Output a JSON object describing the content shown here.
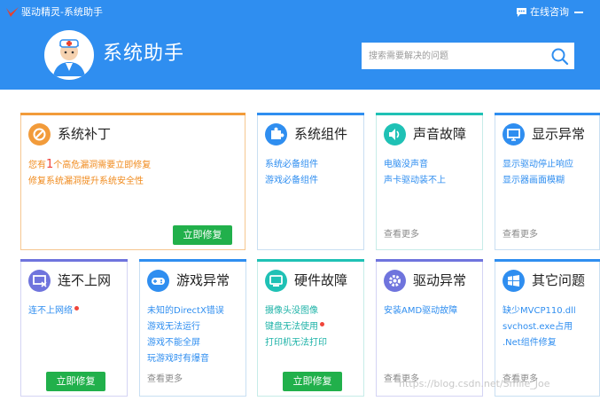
{
  "titlebar": {
    "app_name": "驱动精灵-系统助手",
    "online_label": "在线咨询"
  },
  "header": {
    "title": "系统助手"
  },
  "search": {
    "placeholder": "搜索需要解决的问题"
  },
  "colors": {
    "header": "#2f8ef0",
    "patch": "#f29b3a",
    "link": "#2f8ef0",
    "button": "#21b04b",
    "red_dot": "#f0453a"
  },
  "cards": {
    "patch": {
      "title": "系统补丁",
      "warning": {
        "prefix": "您有",
        "count": "1",
        "suffix": "个高危漏洞需要立即修复"
      },
      "line2": "修复系统漏洞提升系统安全性",
      "button": "立即修复",
      "icon": "wrench-icon"
    },
    "components": {
      "title": "系统组件",
      "items": [
        "系统必备组件",
        "游戏必备组件"
      ],
      "icon": "puzzle-icon"
    },
    "sound": {
      "title": "声音故障",
      "items": [
        "电脑没声音",
        "声卡驱动装不上"
      ],
      "more": "查看更多",
      "icon": "speaker-icon"
    },
    "display": {
      "title": "显示异常",
      "items": [
        "显示驱动停止响应",
        "显示器画面模糊"
      ],
      "more": "查看更多",
      "icon": "monitor-icon"
    },
    "network": {
      "title": "连不上网",
      "items": [
        "连不上网络"
      ],
      "button": "立即修复",
      "icon": "network-icon"
    },
    "game": {
      "title": "游戏异常",
      "items": [
        "未知的DirectX错误",
        "游戏无法运行",
        "游戏不能全屏",
        "玩游戏时有爆音"
      ],
      "more": "查看更多",
      "icon": "gamepad-icon"
    },
    "hardware": {
      "title": "硬件故障",
      "items": [
        "摄像头没图像",
        "键盘无法使用",
        "打印机无法打印"
      ],
      "button": "立即修复",
      "icon": "hardware-icon"
    },
    "driver": {
      "title": "驱动异常",
      "items": [
        "安装AMD驱动故障"
      ],
      "more": "查看更多",
      "icon": "gear-icon"
    },
    "other": {
      "title": "其它问题",
      "items": [
        "缺少MVCP110.dll",
        "svchost.exe占用",
        ".Net组件修复"
      ],
      "more": "查看更多",
      "icon": "windows-icon"
    }
  },
  "watermark": "https://blog.csdn.net/Smile_Joe"
}
